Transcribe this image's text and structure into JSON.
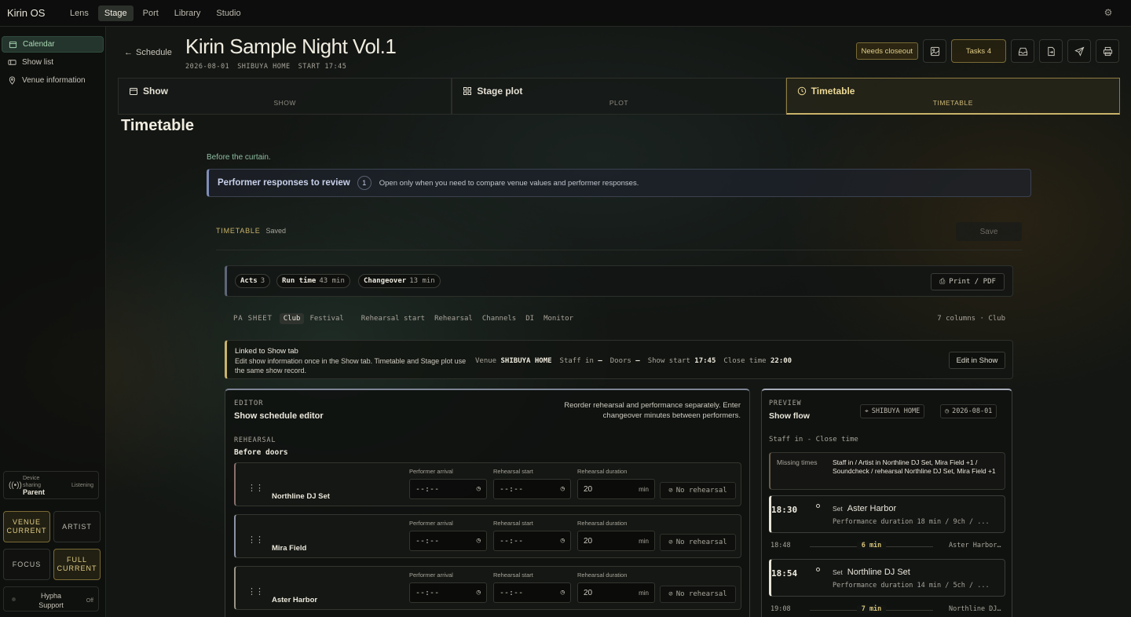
{
  "app": {
    "brand": "Kirin OS",
    "nav": [
      {
        "label": "Lens",
        "active": false
      },
      {
        "label": "Stage",
        "active": true
      },
      {
        "label": "Port",
        "active": false
      },
      {
        "label": "Library",
        "active": false
      },
      {
        "label": "Studio",
        "active": false
      }
    ]
  },
  "sidebar": {
    "items": [
      {
        "label": "Calendar",
        "icon": "calendar-icon"
      },
      {
        "label": "Show list",
        "icon": "ticket-icon"
      },
      {
        "label": "Venue information",
        "icon": "map-pin-icon"
      }
    ],
    "device": {
      "label": "Device sharing",
      "role": "Parent",
      "status": "Listening"
    },
    "modes": {
      "venue": "VENUE",
      "venue_sub": "CURRENT",
      "artist": "ARTIST",
      "focus": "FOCUS",
      "full": "FULL",
      "full_sub": "CURRENT"
    },
    "hypha": {
      "label": "Hypha Support",
      "status": "Off"
    }
  },
  "header": {
    "back": "Schedule",
    "title": "Kirin Sample Night Vol.1",
    "date": "2026-08-01",
    "venue": "SHIBUYA HOME",
    "start": "START 17:45",
    "needs_closeout": "Needs closeout",
    "tasks": "Tasks 4"
  },
  "tabs": [
    {
      "label": "Show",
      "sub": "SHOW",
      "icon": "calendar-icon"
    },
    {
      "label": "Stage plot",
      "sub": "PLOT",
      "icon": "grid-icon"
    },
    {
      "label": "Timetable",
      "sub": "TIMETABLE",
      "icon": "clock-icon"
    }
  ],
  "page": {
    "heading": "Timetable",
    "subtitle": "Before the curtain.",
    "review": {
      "title": "Performer responses to review",
      "count": "1",
      "desc": "Open only when you need to compare venue values and performer responses."
    },
    "timetable_label": "TIMETABLE",
    "saved": "Saved",
    "save": "Save"
  },
  "stats": {
    "acts_label": "Acts",
    "acts": "3",
    "run_label": "Run time",
    "run": "43 min",
    "change_label": "Changeover",
    "change": "13 min",
    "print": "Print / PDF"
  },
  "pa": {
    "label": "PA SHEET",
    "modes": [
      "Club",
      "Festival"
    ],
    "sections": [
      "Rehearsal start",
      "Rehearsal",
      "Channels",
      "DI",
      "Monitor"
    ],
    "summary": "7 columns · Club"
  },
  "linked": {
    "title": "Linked to Show tab",
    "desc": "Edit show information once in the Show tab. Timetable and Stage plot use the same show record.",
    "venue_label": "Venue",
    "venue": "SHIBUYA HOME",
    "staff_label": "Staff in",
    "staff": "—",
    "doors_label": "Doors",
    "doors": "—",
    "start_label": "Show start",
    "start": "17:45",
    "close_label": "Close time",
    "close": "22:00",
    "edit": "Edit in Show"
  },
  "editor": {
    "eyebrow": "EDITOR",
    "title": "Show schedule editor",
    "desc": "Reorder rehearsal and performance separately. Enter changeover minutes between performers.",
    "section": "REHEARSAL",
    "section_sub": "Before doors",
    "field_arrival": "Performer arrival",
    "field_start": "Rehearsal start",
    "field_duration": "Rehearsal duration",
    "placeholder": "--:--",
    "min": "min",
    "no_rehearsal": "No rehearsal",
    "acts": [
      {
        "name": "Northline DJ Set",
        "duration": "20",
        "accent": "#8a6f6c"
      },
      {
        "name": "Mira Field",
        "duration": "20",
        "accent": "#8d93a6"
      },
      {
        "name": "Aster Harbor",
        "duration": "20",
        "accent": "#9a9488"
      }
    ]
  },
  "preview": {
    "eyebrow": "PREVIEW",
    "title": "Show flow",
    "venue": "SHIBUYA HOME",
    "date": "2026-08-01",
    "range": "Staff in - Close time",
    "missing_label": "Missing times",
    "missing_text": "Staff in / Artist in Northline DJ Set, Mira Field +1 / Soundcheck / rehearsal Northline DJ Set, Mira Field +1",
    "sets": [
      {
        "time": "18:30",
        "kind": "Set",
        "name": "Aster Harbor",
        "detail": "Performance duration 18 min / 9ch / ..."
      },
      {
        "time": "18:54",
        "kind": "Set",
        "name": "Northline DJ Set",
        "detail": "Performance duration 14 min / 5ch / ..."
      }
    ],
    "changeovers": [
      {
        "time": "18:48",
        "minutes": "6 min",
        "next": "Aster Harbor..."
      },
      {
        "time": "19:08",
        "minutes": "7 min",
        "next": "Northline DJ ..."
      }
    ]
  }
}
